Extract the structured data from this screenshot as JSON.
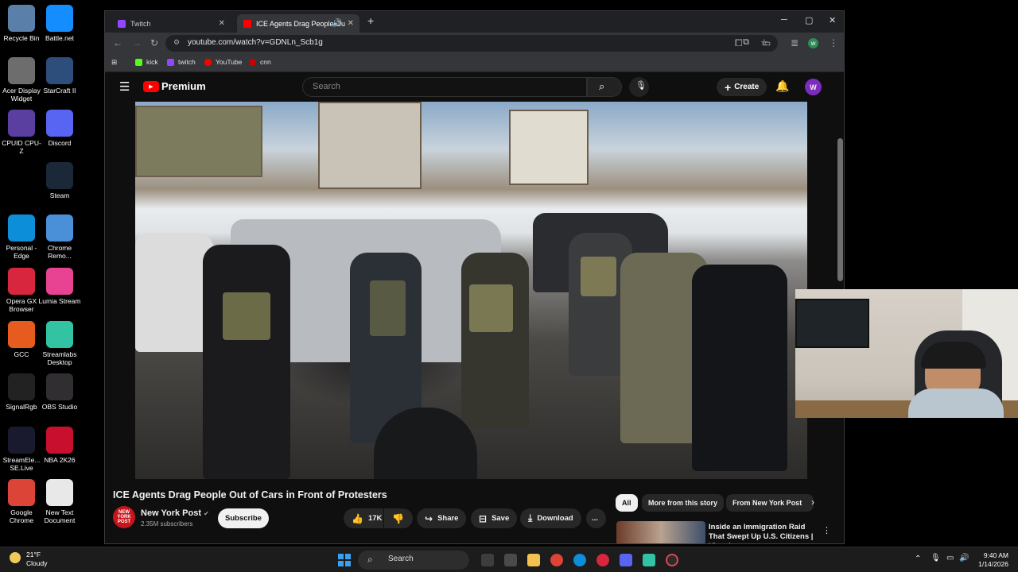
{
  "desktop": {
    "icons": [
      {
        "label": "Recycle Bin",
        "color": "#5a7fa8"
      },
      {
        "label": "Battle.net",
        "color": "#148eff"
      },
      {
        "label": "Acer Display Widget",
        "color": "#6d6d6d"
      },
      {
        "label": "StarCraft II",
        "color": "#2d4e7a"
      },
      {
        "label": "CPUID CPU-Z",
        "color": "#5a3fa0"
      },
      {
        "label": "Discord",
        "color": "#5865f2"
      },
      {
        "label": "Steam",
        "color": "#1b2838"
      },
      {
        "label": "Personal - Edge",
        "color": "#0c8ed9"
      },
      {
        "label": "Chrome Remo...",
        "color": "#4a90d9"
      },
      {
        "label": "Opera GX Browser",
        "color": "#d7263d"
      },
      {
        "label": "Lumia Stream",
        "color": "#e84393"
      },
      {
        "label": "GCC",
        "color": "#e65c1e"
      },
      {
        "label": "Streamlabs Desktop",
        "color": "#31c3a2"
      },
      {
        "label": "SignalRgb",
        "color": "#222222"
      },
      {
        "label": "OBS Studio",
        "color": "#302e31"
      },
      {
        "label": "StreamEle... SE.Live",
        "color": "#1a1a2e"
      },
      {
        "label": "NBA 2K26",
        "color": "#c8102e"
      },
      {
        "label": "Google Chrome",
        "color": "#db4437"
      },
      {
        "label": "New Text Document",
        "color": "#e8e8e8"
      }
    ]
  },
  "browser": {
    "tabs": [
      {
        "title": "Twitch",
        "color": "#9146ff"
      },
      {
        "title": "ICE Agents Drag People Ou",
        "color": "#ff0000"
      }
    ],
    "url": "youtube.com/watch?v=GDNLn_Scb1g",
    "bookmarks": [
      {
        "label": "kick",
        "color": "#53fc18"
      },
      {
        "label": "twitch",
        "color": "#9146ff"
      },
      {
        "label": "YouTube",
        "color": "#ff0000"
      },
      {
        "label": "cnn",
        "color": "#cc0000"
      }
    ],
    "profile_initial": "w"
  },
  "youtube": {
    "logo_text": "Premium",
    "search_placeholder": "Search",
    "create_label": "Create",
    "avatar_initial": "W",
    "video_title": "ICE Agents Drag People Out of Cars in Front of Protesters",
    "channel": {
      "name": "New York Post",
      "subscribers": "2.35M subscribers",
      "logo_text": "NEW YORK POST"
    },
    "subscribe_label": "Subscribe",
    "actions": {
      "likes": "17K",
      "share": "Share",
      "save": "Save",
      "download": "Download",
      "more": "..."
    },
    "chips": [
      "All",
      "More from this story",
      "From New York Post"
    ],
    "recommendation": {
      "title": "Inside an Immigration Raid That Swept Up U.S. Citizens | Visual..."
    }
  },
  "taskbar": {
    "weather_temp": "21°F",
    "weather_desc": "Cloudy",
    "search_label": "Search",
    "time": "9:40 AM",
    "date": "1/14/2026"
  }
}
